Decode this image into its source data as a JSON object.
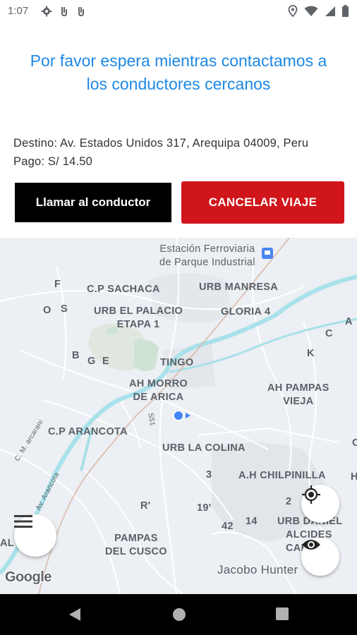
{
  "status_bar": {
    "time": "1:07",
    "left_icons": [
      "gear-icon",
      "notification-icon",
      "notification-icon"
    ],
    "right_icons": [
      "location-icon",
      "wifi-icon",
      "signal-icon",
      "battery-icon"
    ]
  },
  "header": {
    "waiting_message": "Por favor espera mientras contactamos a los conductores cercanos",
    "destination_label": "Destino:",
    "destination_value": "Av. Estados Unidos 317, Arequipa 04009, Peru",
    "payment_label": "Pago:",
    "payment_value": "S/ 14.50",
    "call_driver_label": "Llamar al conductor",
    "cancel_trip_label": "CANCELAR VIAJE"
  },
  "colors": {
    "accent_blue": "#1e88e5",
    "cancel_red": "#d0161b",
    "call_black": "#000000",
    "map_bg": "#eceff3",
    "river": "#a8e1ea"
  },
  "map": {
    "labels": {
      "station_line1": "Estación Ferroviaria",
      "station_line2": "de Parque Industrial",
      "f": "F",
      "cp_sachaca": "C.P SACHACA",
      "urb_manresa": "URB MANRESA",
      "o": "O",
      "s": "S",
      "urb_el_palacio_line1": "URB EL PALACIO",
      "urb_el_palacio_line2": "ETAPA 1",
      "gloria": "GLORIA 4",
      "a": "A",
      "c": "C",
      "b": "B",
      "g": "G",
      "e": "E",
      "tingo": "TINGO",
      "k": "K",
      "ah_morro_line1": "AH MORRO",
      "ah_morro_line2": "DE ARICA",
      "ah_pampas_line1": "AH PAMPAS",
      "ah_pampas_line2": "VIEJA",
      "road_s51": "S51",
      "c_m_arcarani": "C. M. arcarani",
      "cp_arancota": "C.P ARANCOTA",
      "urb_la_colina": "URB LA COLINA",
      "av_arancota": "Av. Arancota",
      "three": "3",
      "ah_chilpinilla": "A.H CHILPINILLA",
      "r": "R'",
      "nineteen": "19'",
      "two": "2",
      "h": "H",
      "c_right": "C",
      "fortytwo": "42",
      "fourteen": "14",
      "urb_daniel_line1": "URB DANIEL",
      "urb_daniel_line2": "ALCIDES",
      "urb_daniel_line3": "CAR",
      "al": "AL",
      "pampas_cusco_line1": "PAMPAS",
      "pampas_cusco_line2": "DEL CUSCO",
      "jacobo_hunter": "Jacobo Hunter",
      "google": "Google"
    },
    "controls": {
      "menu_icon": "menu-icon",
      "my_location_icon": "my-location-icon",
      "eye_icon": "eye-icon"
    }
  },
  "nav_bar": {
    "buttons": [
      "back-icon",
      "home-icon",
      "recents-icon"
    ]
  }
}
